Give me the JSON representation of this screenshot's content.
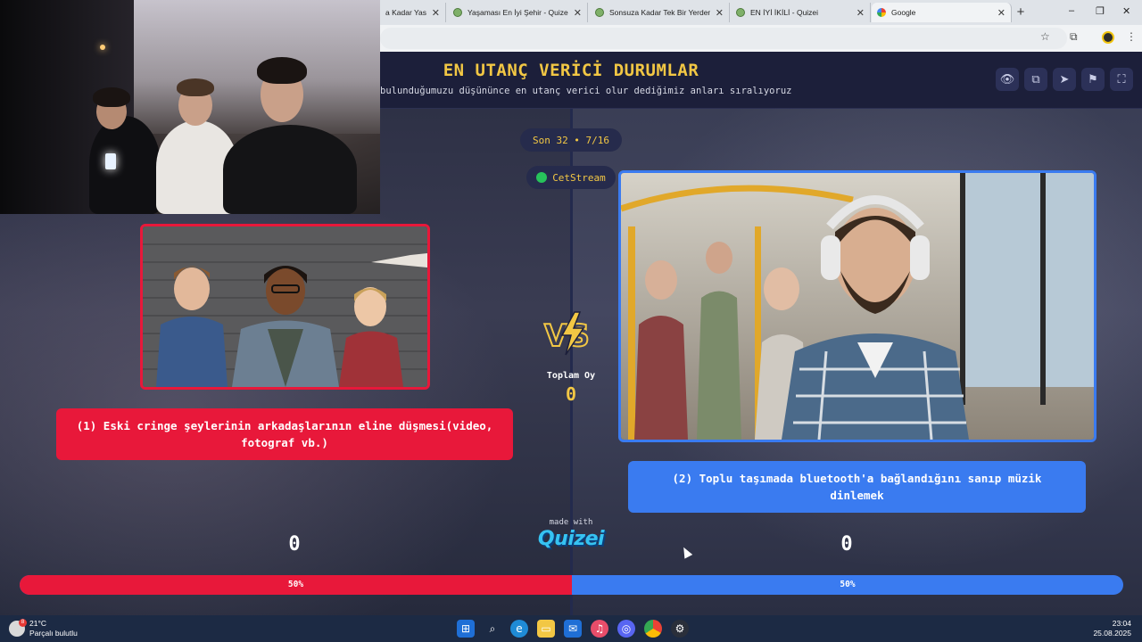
{
  "browser": {
    "tabs": [
      {
        "label": "a Kadar Yasak",
        "icon": "quizei-favicon"
      },
      {
        "label": "Yaşaması En İyi Şehir - Quizei",
        "icon": "quizei-favicon"
      },
      {
        "label": "Sonsuza Kadar Tek Bir Yerden B",
        "icon": "quizei-favicon"
      },
      {
        "label": "EN İYİ İKİLİ - Quizei",
        "icon": "quizei-favicon"
      },
      {
        "label": "Google",
        "icon": "google-favicon"
      }
    ],
    "new_tab": "+",
    "window_controls": {
      "minimize": "‒",
      "restore": "❐",
      "close": "✕"
    }
  },
  "quiz": {
    "title": "EN UTANÇ VERİCİ DURUMLAR",
    "subtitle": "bulunduğumuzu düşününce en utanç verici olur dediğimiz anları sıralıyoruz",
    "header_buttons": [
      "eye-icon",
      "copy-icon",
      "send-icon",
      "flag-icon",
      "fullscreen-icon"
    ],
    "round": "Son 32 • 7/16",
    "streamer": "CetStream",
    "total_label": "Toplam Oy",
    "total_value": "0",
    "options": [
      {
        "label": "(1) Eski cringe şeylerinin arkadaşlarının eline düşmesi(video, fotograf vb.)",
        "votes": "0",
        "percent_label": "50%",
        "percent": 50,
        "color": "#e8183a"
      },
      {
        "label": "(2) Toplu taşımada bluetooth'a bağlandığını sanıp müzik dinlemek",
        "votes": "0",
        "percent_label": "50%",
        "percent": 50,
        "color": "#3a7bf0"
      }
    ],
    "made_with": "made with",
    "brand": "Quizei"
  },
  "taskbar": {
    "weather_temp": "21°C",
    "weather_desc": "Parçalı bulutlu",
    "weather_badge": "8",
    "apps": [
      "windows-start-icon",
      "search-icon",
      "edge-icon",
      "file-explorer-icon",
      "outlook-icon",
      "music-icon",
      "discord-icon",
      "chrome-icon",
      "steam-icon"
    ],
    "time": "23:04",
    "date": "25.08.2025"
  }
}
